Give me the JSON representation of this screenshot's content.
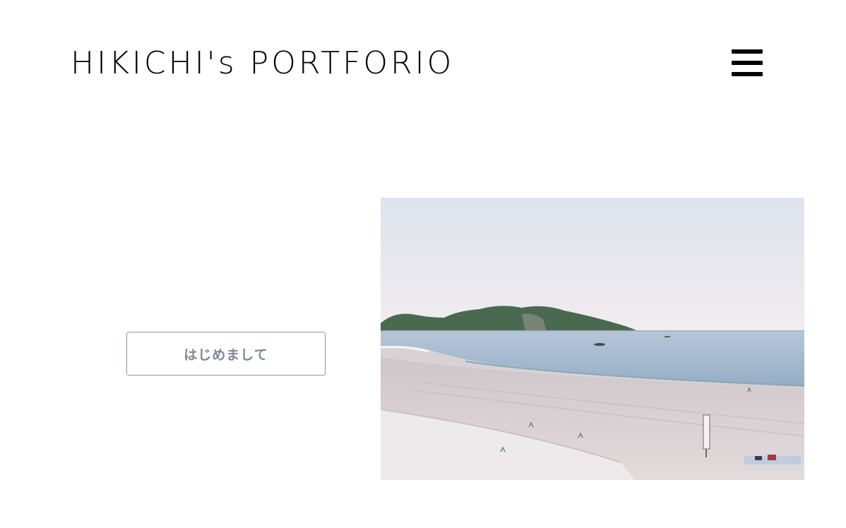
{
  "header": {
    "site_title": "HIKICHI's PORTFORIO",
    "menu_icon": "hamburger-menu-icon"
  },
  "main": {
    "intro_button_label": "はじめまして",
    "hero_image": {
      "subject": "beach-photo"
    }
  },
  "colors": {
    "title_text": "#000000",
    "button_border": "#8a96a3",
    "button_text": "#7d8896",
    "sky": "#e8e9f0",
    "sea": "#9fb3c8",
    "sand": "#ddd4d3"
  }
}
